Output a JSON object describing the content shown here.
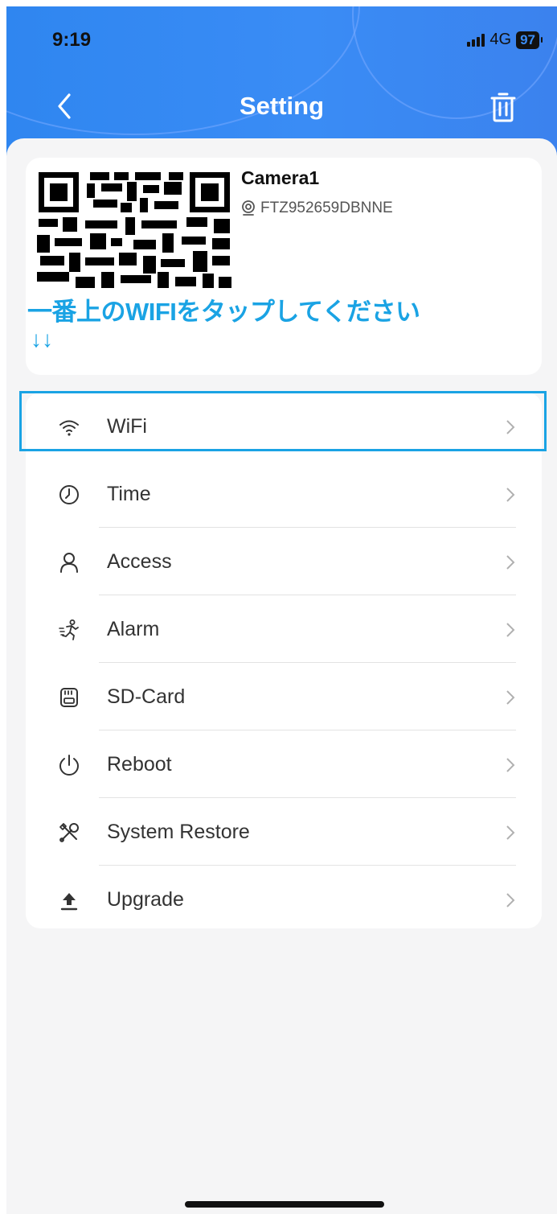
{
  "status_bar": {
    "time": "9:19",
    "network": "4G",
    "battery": "97"
  },
  "header": {
    "title": "Setting",
    "back_icon": "chevron-left-icon",
    "action_icon": "trash-icon"
  },
  "device": {
    "name": "Camera1",
    "id": "FTZ952659DBNNE",
    "id_icon": "webcam-icon"
  },
  "instruction": {
    "text": "一番上のWIFIをタップしてください",
    "arrows": "↓↓"
  },
  "menu": {
    "items": [
      {
        "label": "WiFi",
        "icon": "wifi-icon"
      },
      {
        "label": "Time",
        "icon": "clock-icon"
      },
      {
        "label": "Access",
        "icon": "user-icon"
      },
      {
        "label": "Alarm",
        "icon": "running-person-icon"
      },
      {
        "label": "SD-Card",
        "icon": "sd-card-icon"
      },
      {
        "label": "Reboot",
        "icon": "power-icon"
      },
      {
        "label": "System Restore",
        "icon": "tools-icon"
      },
      {
        "label": "Upgrade",
        "icon": "upload-icon"
      }
    ]
  },
  "colors": {
    "header_blue": "#3a8cf5",
    "instruction_blue": "#1aa3e4",
    "background": "#f5f5f6"
  }
}
